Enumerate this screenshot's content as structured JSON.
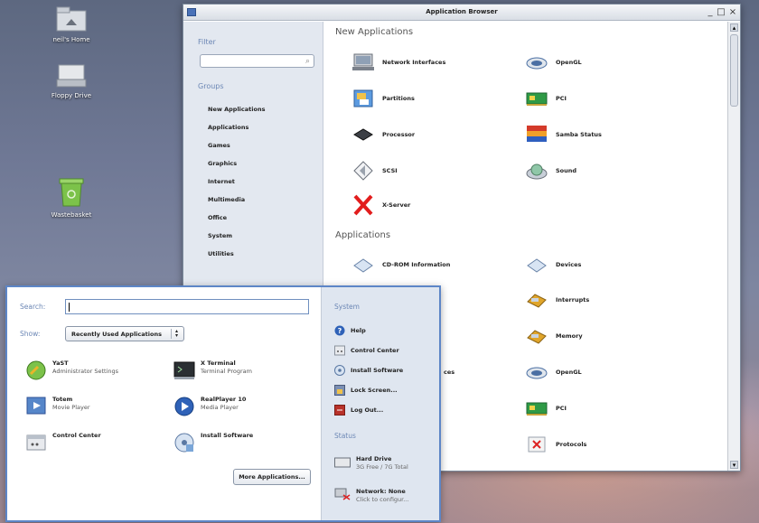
{
  "desktop": {
    "icons": [
      {
        "label": "neil's Home"
      },
      {
        "label": "Floppy Drive"
      },
      {
        "label": "Wastebasket"
      }
    ]
  },
  "browser": {
    "title": "Application Browser",
    "controls": {
      "minimize": "_",
      "maximize": "□",
      "close": "×"
    },
    "filter_label": "Filter",
    "groups_label": "Groups",
    "groups": [
      "New Applications",
      "Applications",
      "Games",
      "Graphics",
      "Internet",
      "Multimedia",
      "Office",
      "System",
      "Utilities"
    ],
    "sections": [
      {
        "title": "New Applications",
        "apps": [
          {
            "label": "Network Interfaces",
            "icon": "network-icon"
          },
          {
            "label": "OpenGL",
            "icon": "opengl-icon"
          },
          {
            "label": "Partitions",
            "icon": "partitions-icon"
          },
          {
            "label": "PCI",
            "icon": "pci-card-icon"
          },
          {
            "label": "Processor",
            "icon": "processor-icon"
          },
          {
            "label": "Samba Status",
            "icon": "samba-icon"
          },
          {
            "label": "SCSI",
            "icon": "scsi-icon"
          },
          {
            "label": "Sound",
            "icon": "sound-icon"
          },
          {
            "label": "X-Server",
            "icon": "x-server-icon"
          }
        ]
      },
      {
        "title": "Applications",
        "apps": [
          {
            "label": "CD-ROM Information",
            "icon": "cdrom-icon"
          },
          {
            "label": "Devices",
            "icon": "devices-icon"
          },
          {
            "label": "Interrupts",
            "icon": "interrupts-icon"
          },
          {
            "label": "Memory",
            "icon": "memory-icon"
          },
          {
            "label": "OpenGL",
            "icon": "opengl-icon"
          },
          {
            "label": "PCI",
            "icon": "pci-card-icon"
          },
          {
            "label": "Protocols",
            "icon": "protocols-icon"
          }
        ]
      }
    ],
    "partial_text": "ces"
  },
  "menu": {
    "search_label": "Search:",
    "show_label": "Show:",
    "show_value": "Recently Used Applications",
    "apps": [
      {
        "name": "YaST",
        "desc": "Administrator Settings",
        "icon": "yast-icon"
      },
      {
        "name": "X Terminal",
        "desc": "Terminal Program",
        "icon": "terminal-icon"
      },
      {
        "name": "Totem",
        "desc": "Movie Player",
        "icon": "totem-icon"
      },
      {
        "name": "RealPlayer 10",
        "desc": "Media Player",
        "icon": "realplayer-icon"
      },
      {
        "name": "Control Center",
        "desc": "",
        "icon": "control-center-icon"
      },
      {
        "name": "Install Software",
        "desc": "",
        "icon": "install-software-icon"
      }
    ],
    "more_button": "More Applications...",
    "system_label": "System",
    "system_items": [
      {
        "label": "Help",
        "icon": "help-icon"
      },
      {
        "label": "Control Center",
        "icon": "control-center-icon"
      },
      {
        "label": "Install Software",
        "icon": "install-software-icon"
      },
      {
        "label": "Lock Screen...",
        "icon": "lock-screen-icon"
      },
      {
        "label": "Log Out...",
        "icon": "logout-icon"
      }
    ],
    "status_label": "Status",
    "status_items": [
      {
        "title": "Hard Drive",
        "detail": "3G Free / 7G Total",
        "icon": "hard-drive-icon"
      },
      {
        "title": "Network: None",
        "detail": "Click to configur...",
        "icon": "network-status-icon"
      }
    ]
  }
}
